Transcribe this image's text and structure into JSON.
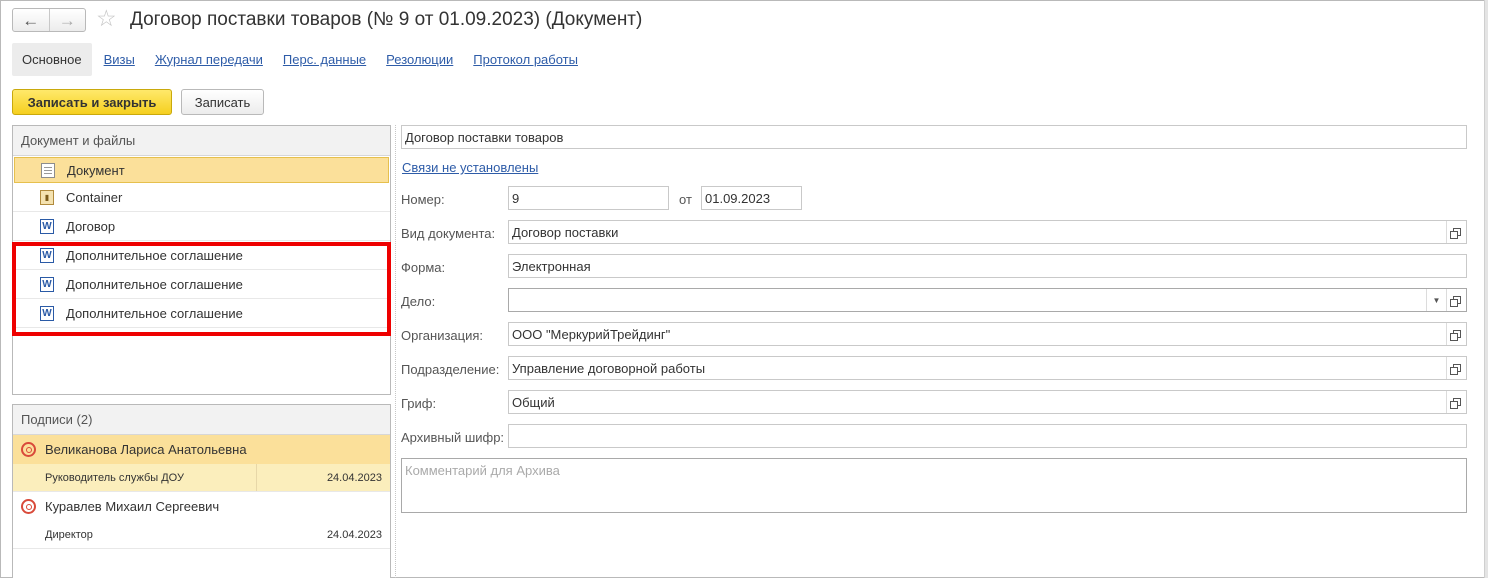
{
  "window": {
    "title": "Договор поставки товаров (№ 9 от 01.09.2023) (Документ)",
    "back_icon": "←",
    "forward_icon": "→",
    "favorite_icon": "☆"
  },
  "tabs": [
    {
      "label": "Основное",
      "active": true
    },
    {
      "label": "Визы"
    },
    {
      "label": "Журнал передачи"
    },
    {
      "label": "Перс. данные"
    },
    {
      "label": "Резолюции"
    },
    {
      "label": "Протокол работы"
    }
  ],
  "toolbar": {
    "save_close_label": "Записать и закрыть",
    "save_label": "Записать"
  },
  "files": {
    "header": "Документ и файлы",
    "items": [
      {
        "label": "Документ",
        "icon": "document-icon",
        "selected": true
      },
      {
        "label": "Container",
        "icon": "container-icon"
      },
      {
        "label": "Договор",
        "icon": "word-icon"
      },
      {
        "label": "Дополнительное соглашение",
        "icon": "word-icon"
      },
      {
        "label": "Дополнительное соглашение",
        "icon": "word-icon"
      },
      {
        "label": "Дополнительное соглашение",
        "icon": "word-icon"
      }
    ]
  },
  "signatures": {
    "header": "Подписи (2)",
    "items": [
      {
        "name": "Великанова Лариса Анатольевна",
        "role": "Руководитель службы ДОУ",
        "date": "24.04.2023",
        "selected": true
      },
      {
        "name": "Куравлев Михаил Сергеевич",
        "role": "Директор",
        "date": "24.04.2023"
      }
    ]
  },
  "form": {
    "title_value": "Договор поставки товаров",
    "links_text": "Связи не установлены",
    "number_label": "Номер:",
    "number_value": "9",
    "from_label": "от",
    "date_value": "01.09.2023",
    "doc_type_label": "Вид документа:",
    "doc_type_value": "Договор поставки",
    "form_label": "Форма:",
    "form_value": "Электронная",
    "case_label": "Дело:",
    "case_value": "",
    "org_label": "Организация:",
    "org_value": "ООО \"МеркурийТрейдинг\"",
    "dept_label": "Подразделение:",
    "dept_value": "Управление договорной работы",
    "grif_label": "Гриф:",
    "grif_value": "Общий",
    "archive_label": "Архивный шифр:",
    "archive_value": "",
    "comment_placeholder": "Комментарий для Архива"
  },
  "colors": {
    "accent_yellow": "#f5cf1f",
    "selection": "#fbe09a",
    "link_blue": "#2e5ca8",
    "highlight_red": "#ee0000"
  }
}
